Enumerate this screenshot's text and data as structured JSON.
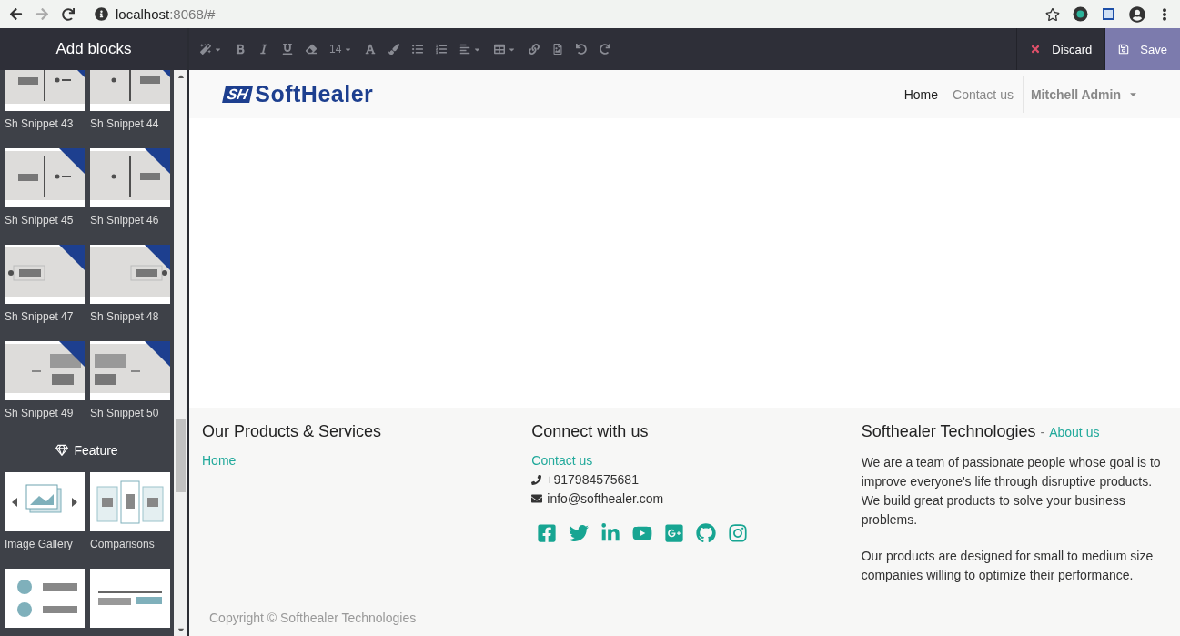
{
  "browser": {
    "back_disabled": false,
    "forward_disabled": true,
    "url_host": "localhost",
    "url_rest": ":8068/#"
  },
  "sidebar": {
    "title": "Add blocks",
    "groups": [
      {
        "blocks": [
          {
            "label": "Sh Snippet 43",
            "kind": "timeline-right",
            "badge": true
          },
          {
            "label": "Sh Snippet 44",
            "kind": "timeline-left",
            "badge": true
          },
          {
            "label": "Sh Snippet 45",
            "kind": "timeline-right",
            "badge": true
          },
          {
            "label": "Sh Snippet 46",
            "kind": "timeline-left",
            "badge": true
          },
          {
            "label": "Sh Snippet 47",
            "kind": "box-left",
            "badge": true
          },
          {
            "label": "Sh Snippet 48",
            "kind": "box-right",
            "badge": true
          },
          {
            "label": "Sh Snippet 49",
            "kind": "photo-right",
            "badge": true
          },
          {
            "label": "Sh Snippet 50",
            "kind": "photo-left",
            "badge": true
          }
        ]
      },
      {
        "heading": "Feature",
        "blocks": [
          {
            "label": "Image Gallery",
            "kind": "gallery",
            "badge": false
          },
          {
            "label": "Comparisons",
            "kind": "comparison",
            "badge": false
          },
          {
            "kind": "team",
            "badge": false
          },
          {
            "kind": "cta",
            "badge": false
          }
        ]
      }
    ]
  },
  "toolbar": {
    "font_size": "14"
  },
  "actions": [
    {
      "label": "Discard",
      "kind": "discard"
    },
    {
      "label": "Save",
      "kind": "save"
    }
  ],
  "navbar": {
    "logo_mark": "SH",
    "logo_name": "SoftHealer",
    "links": [
      {
        "label": "Home",
        "selected": true
      },
      {
        "label": "Contact us",
        "selected": false
      }
    ],
    "user": "Mitchell Admin"
  },
  "footer": {
    "products": {
      "title": "Our Products & Services",
      "links": [
        "Home"
      ]
    },
    "connect": {
      "title": "Connect with us",
      "link": "Contact us",
      "phone": "+917984575681",
      "email": "info@softhealer.com",
      "socials": [
        {
          "kind": "facebook"
        },
        {
          "kind": "twitter"
        },
        {
          "kind": "linkedin"
        },
        {
          "kind": "youtube"
        },
        {
          "kind": "googleplus"
        },
        {
          "kind": "github"
        },
        {
          "kind": "instagram"
        }
      ]
    },
    "about": {
      "title": "Softhealer Technologies",
      "separator": "-",
      "link": "About us",
      "paragraphs": [
        "We are a team of passionate people whose goal is to improve everyone's life through disruptive products. We build great products to solve your business problems.",
        "Our products are designed for small to medium size companies willing to optimize their performance."
      ]
    },
    "copyright": "Copyright © Softhealer Technologies"
  }
}
